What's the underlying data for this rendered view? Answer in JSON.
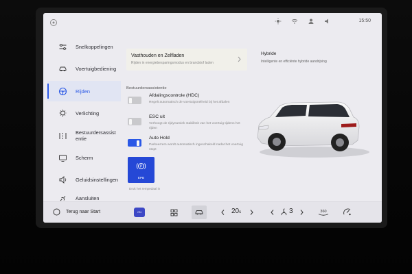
{
  "status_bar": {
    "time": "15:50",
    "icons": [
      "brightness-icon",
      "wifi-icon",
      "profile-icon",
      "sound-icon"
    ]
  },
  "sidebar": {
    "items": [
      {
        "label": "Snelkoppelingen",
        "icon": "switches-icon",
        "active": false
      },
      {
        "label": "Voertuigbediening",
        "icon": "car-icon",
        "active": false
      },
      {
        "label": "Rijden",
        "icon": "steering-wheel-icon",
        "active": true
      },
      {
        "label": "Verlichting",
        "icon": "light-bulb-icon",
        "active": false
      },
      {
        "label": "Bestuurdersassist entie",
        "icon": "driver-assist-icon",
        "active": false
      },
      {
        "label": "Scherm",
        "icon": "screen-icon",
        "active": false
      },
      {
        "label": "Geluidsinstellingen",
        "icon": "speaker-icon",
        "active": false
      },
      {
        "label": "Aansluiten",
        "icon": "connect-icon",
        "active": false
      }
    ]
  },
  "main": {
    "hold_card": {
      "title": "Vasthouden en Zelfladen",
      "subtitle": "Rijden in energiebesparingsmodus en brandstof laden"
    },
    "hybrid": {
      "title": "Hybride",
      "description": "Intelligente en efficiënte hybride aandrijving"
    },
    "section_title": "Bestuurdersassistentie",
    "options": [
      {
        "name": "Afdalingscontrole (HDC)",
        "description": "Regelt automatisch de voertuigsnelheid bij het afdalen",
        "enabled": false
      },
      {
        "name": "ESC uit",
        "description": "Verhoogt de rijdynamiek stabiliteit van het voertuig tijdens het rijden",
        "enabled": false
      },
      {
        "name": "Auto Hold",
        "description": "Parkeerrem wordt automatisch ingeschakeld nadat het voertuig stopt",
        "enabled": true
      }
    ],
    "epb": {
      "label": "EPB",
      "note": "Druk het rempedaal in"
    }
  },
  "bottom_bar": {
    "back_label": "Terug naar Start",
    "app_badge": "CN",
    "temperature": "20",
    "temperature_unit": "s",
    "fan_level": "3",
    "view_360": "360"
  },
  "colors": {
    "accent": "#2a58e6",
    "epb": "#2548d6",
    "screen_bg": "#ecebf0"
  }
}
